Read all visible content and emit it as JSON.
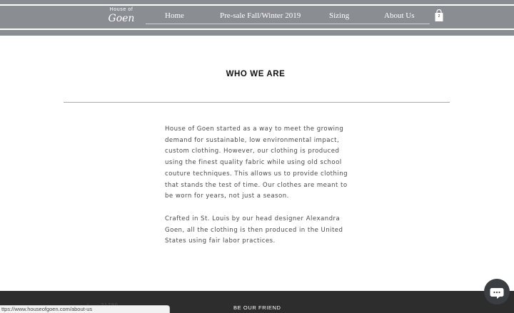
{
  "header": {
    "logo": {
      "top_text": "House of",
      "script_text": "Goen"
    },
    "nav": [
      {
        "label": "Home"
      },
      {
        "label": "Pre-sale Fall/Winter 2019"
      },
      {
        "label": "Sizing"
      },
      {
        "label": "About Us"
      }
    ],
    "cart": {
      "count": "2",
      "icon": "shopping-bag-icon"
    }
  },
  "main": {
    "title": "WHO WE ARE",
    "paragraphs": [
      "House of Goen started as a way to meet the growing demand for sustainable, low environmental impact, custom clothing. However, our clothing is produced using the finest quality fabric while using old school couture techniques. This allows us to provide clothing that stands the test of time. Our clothes are meant to be worn for years, not just a season.",
      "Crafted in St. Louis by our head designer Alexandra Goen, all the clothing is then produced in the United States using fair labor practices."
    ]
  },
  "footer": {
    "friend_label": "BE OUR FRIEND",
    "faint_text": "r         ··· 21790"
  },
  "status_bar": {
    "url": "ttps://www.houseofgoen.com/about-us"
  },
  "chat": {
    "icon": "chat-bubble-icon"
  },
  "colors": {
    "header_bg": "#8a8d91",
    "footer_bg": "#2d2d2d",
    "chat_bg": "#3a3d42"
  }
}
